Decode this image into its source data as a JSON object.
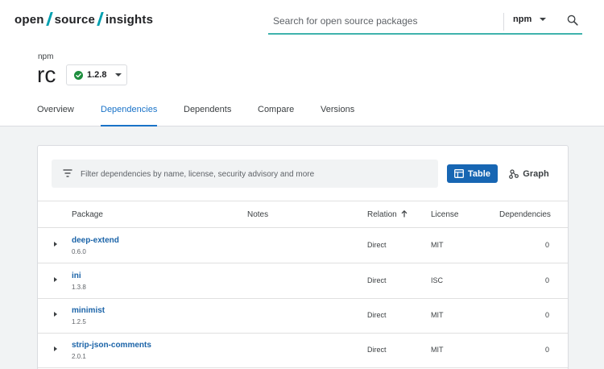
{
  "header": {
    "logo_parts": [
      "open",
      "source",
      "insights"
    ],
    "search": {
      "placeholder": "Search for open source packages",
      "value": ""
    },
    "ecosystem": "npm"
  },
  "package": {
    "system": "npm",
    "name": "rc",
    "version": "1.2.8"
  },
  "tabs": [
    {
      "label": "Overview",
      "active": false
    },
    {
      "label": "Dependencies",
      "active": true
    },
    {
      "label": "Dependents",
      "active": false
    },
    {
      "label": "Compare",
      "active": false
    },
    {
      "label": "Versions",
      "active": false
    }
  ],
  "dependencies": {
    "filter": {
      "placeholder": "Filter dependencies by name, license, security advisory and more",
      "value": ""
    },
    "view_buttons": {
      "table": "Table",
      "graph": "Graph"
    },
    "columns": {
      "package": "Package",
      "notes": "Notes",
      "relation": "Relation",
      "license": "License",
      "dependencies": "Dependencies"
    },
    "rows": [
      {
        "name": "deep-extend",
        "version": "0.6.0",
        "relation": "Direct",
        "license": "MIT",
        "count": "0"
      },
      {
        "name": "ini",
        "version": "1.3.8",
        "relation": "Direct",
        "license": "ISC",
        "count": "0"
      },
      {
        "name": "minimist",
        "version": "1.2.5",
        "relation": "Direct",
        "license": "MIT",
        "count": "0"
      },
      {
        "name": "strip-json-comments",
        "version": "2.0.1",
        "relation": "Direct",
        "license": "MIT",
        "count": "0"
      }
    ]
  },
  "colors": {
    "accent": "#1a73c8",
    "primary_button": "#1766b3",
    "search_underline": "#3fb3ad",
    "logo_slash": "#00a0b0",
    "status_ok": "#1e8e3e"
  }
}
